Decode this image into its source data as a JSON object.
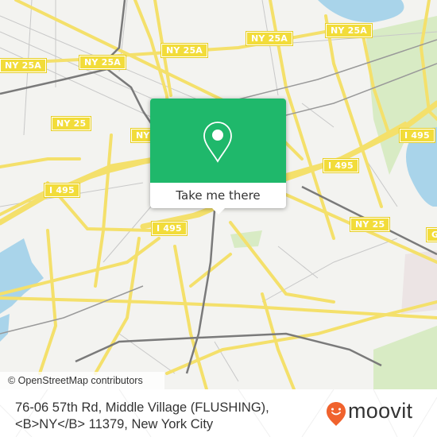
{
  "map": {
    "attribution": "© OpenStreetMap contributors",
    "colors": {
      "land": "#f3f3f0",
      "road_major": "#f4e06b",
      "road_minor": "#c8c8c8",
      "rail": "#7a7a7a",
      "water": "#a9d4ea",
      "park": "#d8ebc4"
    },
    "shields": [
      {
        "label": "NY 25A"
      },
      {
        "label": "NY 25A"
      },
      {
        "label": "NY 25A"
      },
      {
        "label": "NY 25A"
      },
      {
        "label": "NY 25"
      },
      {
        "label": "NY"
      },
      {
        "label": "I 495"
      },
      {
        "label": "I 495"
      },
      {
        "label": "I 495"
      },
      {
        "label": "I 495"
      },
      {
        "label": "NY 25"
      },
      {
        "label": "G"
      }
    ]
  },
  "popup": {
    "icon": "map-pin-icon",
    "button_label": "Take me there",
    "color": "#1fb86b"
  },
  "footer": {
    "address_line1": "76-06 57th Rd, Middle Village (FLUSHING),",
    "address_line2": "<B>NY</B> 11379, New York City",
    "brand": "moovit",
    "brand_color": "#f0622d"
  }
}
